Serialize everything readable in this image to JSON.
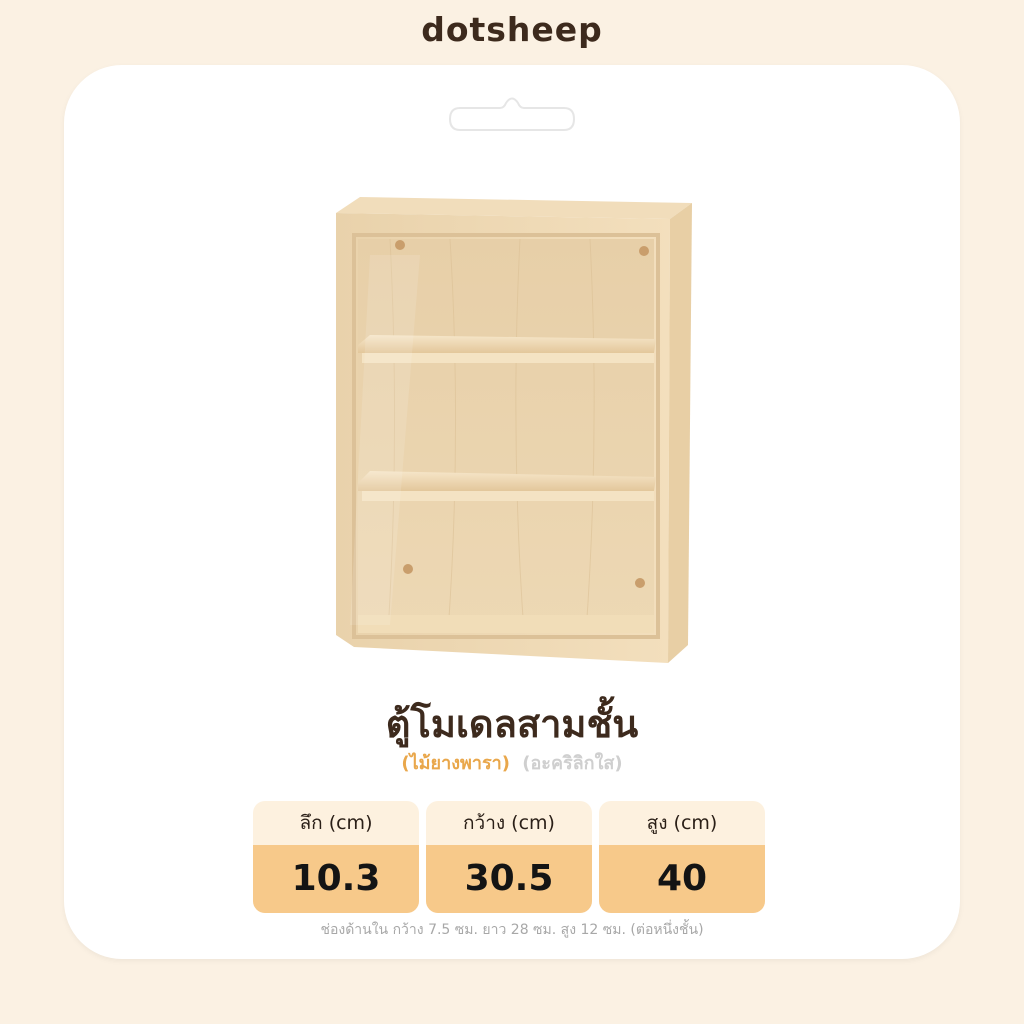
{
  "brand": "dotsheep",
  "product": {
    "title": "ตู้โมเดลสามชั้น",
    "material": "(ไม้ยางพารา)",
    "panel": "(อะคริลิกใส)"
  },
  "dimensions": [
    {
      "label": "ลึก (cm)",
      "value": "10.3"
    },
    {
      "label": "กว้าง (cm)",
      "value": "30.5"
    },
    {
      "label": "สูง (cm)",
      "value": "40"
    }
  ],
  "note": "ช่องด้านใน กว้าง 7.5 ซม. ยาว 28 ซม. สูง 12 ซม. (ต่อหนึ่งชั้น)",
  "colors": {
    "background": "#fbf1e3",
    "accent": "#f7c98a",
    "material_text": "#e9a74b",
    "title_text": "#3d2a1d"
  }
}
